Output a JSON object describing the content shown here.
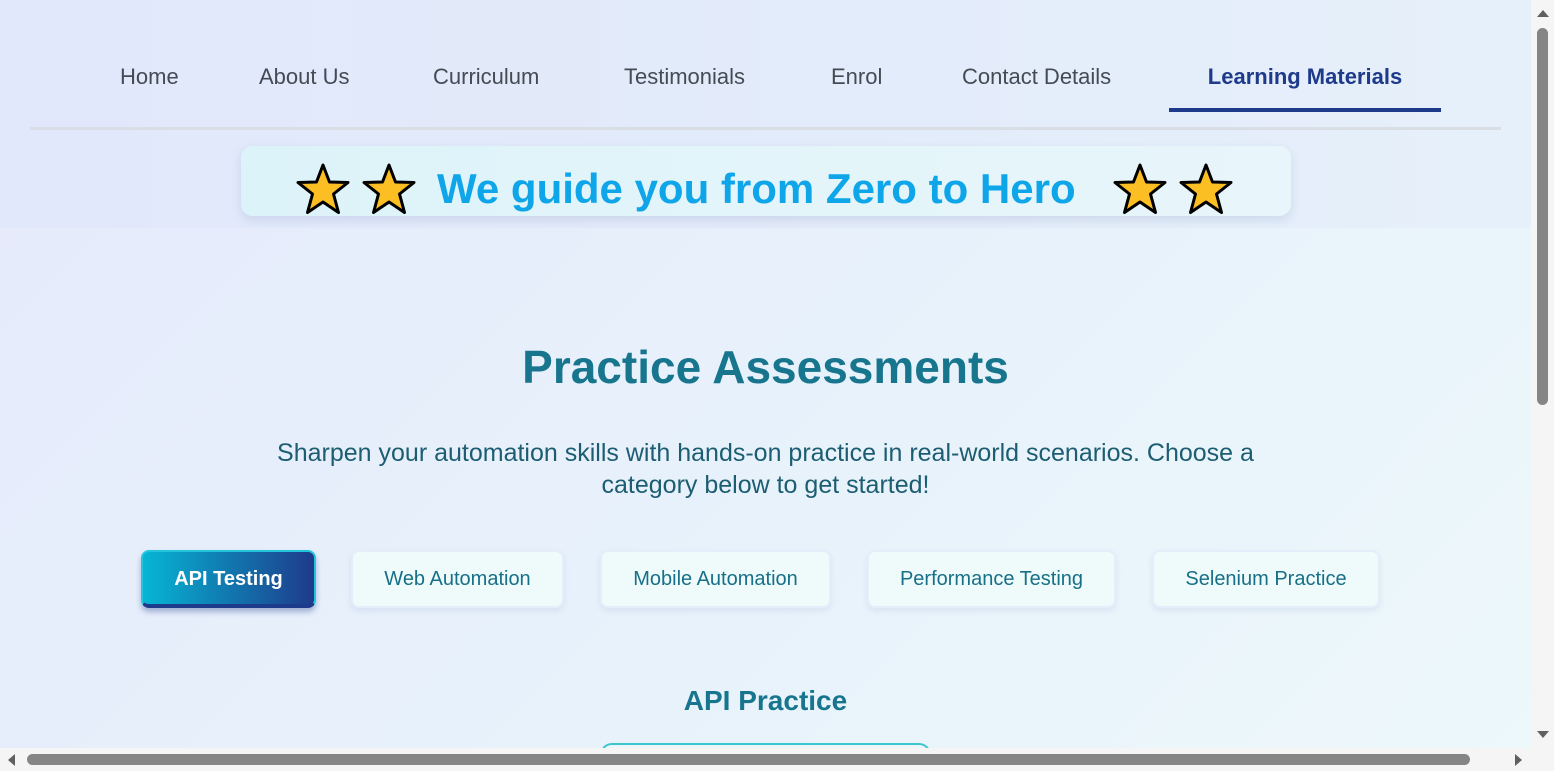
{
  "nav": {
    "items": [
      {
        "label": "Home"
      },
      {
        "label": "About Us"
      },
      {
        "label": "Curriculum"
      },
      {
        "label": "Testimonials"
      },
      {
        "label": "Enrol"
      },
      {
        "label": "Contact Details"
      },
      {
        "label": "Learning Materials",
        "active": true
      }
    ]
  },
  "banner": {
    "text": "We guide you from Zero to Hero",
    "icon": "star-icon",
    "star_color": "#fbbf24"
  },
  "section": {
    "title": "Practice Assessments",
    "description": "Sharpen your automation skills with hands-on practice in real-world scenarios. Choose a category below to get started!"
  },
  "categories": [
    {
      "label": "API Testing",
      "active": true
    },
    {
      "label": "Web Automation"
    },
    {
      "label": "Mobile Automation"
    },
    {
      "label": "Performance Testing"
    },
    {
      "label": "Selenium Practice"
    }
  ],
  "subsection": {
    "title": "API Practice"
  },
  "colors": {
    "accent": "#1e3a8a",
    "primary_teal": "#17758e",
    "banner_text": "#0ea5e9"
  }
}
